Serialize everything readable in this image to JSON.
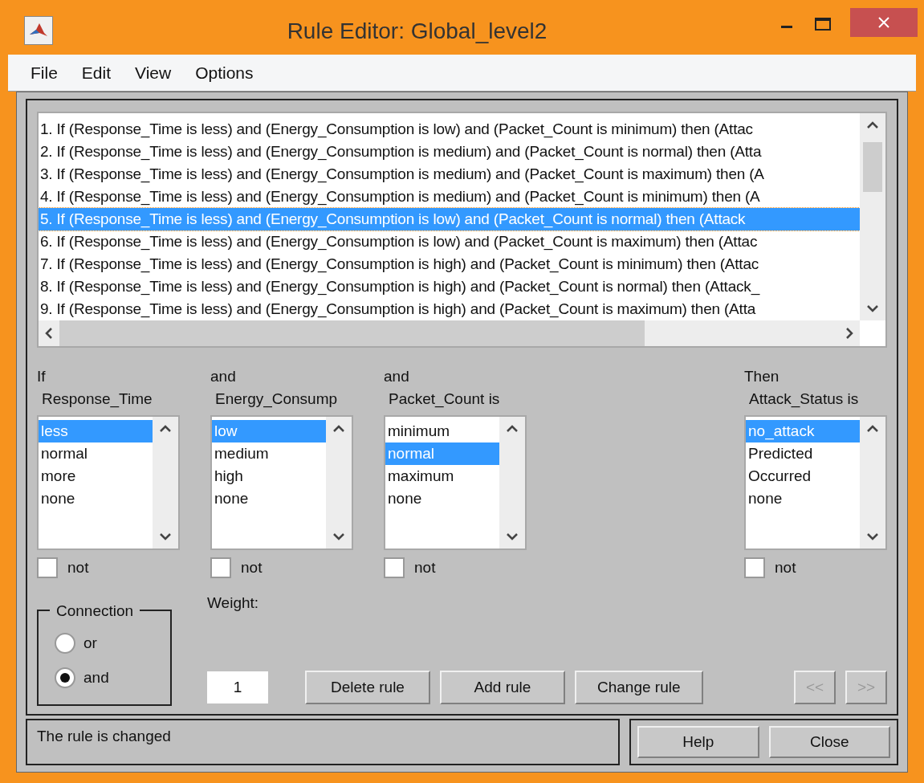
{
  "window": {
    "title": "Rule Editor: Global_level2"
  },
  "menu": [
    "File",
    "Edit",
    "View",
    "Options"
  ],
  "rules": [
    {
      "text": "1. If (Response_Time is less) and (Energy_Consumption is low) and (Packet_Count is minimum) then (Attac",
      "selected": false
    },
    {
      "text": "2. If (Response_Time is less) and (Energy_Consumption is medium) and (Packet_Count is normal) then (Atta",
      "selected": false
    },
    {
      "text": "3. If (Response_Time is less) and (Energy_Consumption is medium) and (Packet_Count is maximum) then (A",
      "selected": false
    },
    {
      "text": "4. If (Response_Time is less) and (Energy_Consumption is medium) and (Packet_Count is minimum) then (A",
      "selected": false
    },
    {
      "text": "5. If (Response_Time is less) and (Energy_Consumption is low) and (Packet_Count is normal) then (Attack",
      "selected": true
    },
    {
      "text": "6. If (Response_Time is less) and (Energy_Consumption is low) and (Packet_Count is maximum) then (Attac",
      "selected": false
    },
    {
      "text": "7. If (Response_Time is less) and (Energy_Consumption is high) and (Packet_Count is minimum) then (Attac",
      "selected": false
    },
    {
      "text": "8. If (Response_Time is less) and (Energy_Consumption is high) and (Packet_Count is normal) then (Attack_",
      "selected": false
    },
    {
      "text": "9. If (Response_Time is less) and (Energy_Consumption is high) and (Packet_Count is maximum) then (Atta",
      "selected": false
    }
  ],
  "variables": [
    {
      "connective": "If",
      "name": "Response_Time",
      "not": false,
      "not_label": "not",
      "options": [
        {
          "label": "less",
          "selected": true
        },
        {
          "label": "normal",
          "selected": false
        },
        {
          "label": "more",
          "selected": false
        },
        {
          "label": "none",
          "selected": false
        }
      ]
    },
    {
      "connective": "and",
      "name": "Energy_Consump",
      "not": false,
      "not_label": "not",
      "options": [
        {
          "label": "low",
          "selected": true
        },
        {
          "label": "medium",
          "selected": false
        },
        {
          "label": "high",
          "selected": false
        },
        {
          "label": "none",
          "selected": false
        }
      ]
    },
    {
      "connective": "and",
      "name": "Packet_Count is",
      "not": false,
      "not_label": "not",
      "options": [
        {
          "label": "minimum",
          "selected": false
        },
        {
          "label": "normal",
          "selected": true
        },
        {
          "label": "maximum",
          "selected": false
        },
        {
          "label": "none",
          "selected": false
        }
      ]
    },
    {
      "connective": "Then",
      "name": "Attack_Status is",
      "not": false,
      "not_label": "not",
      "options": [
        {
          "label": "no_attack",
          "selected": true
        },
        {
          "label": "Predicted",
          "selected": false
        },
        {
          "label": "Occurred",
          "selected": false
        },
        {
          "label": "none",
          "selected": false
        }
      ]
    }
  ],
  "connection": {
    "label": "Connection",
    "options": [
      {
        "label": "or",
        "selected": false
      },
      {
        "label": "and",
        "selected": true
      }
    ]
  },
  "weight": {
    "label": "Weight:",
    "value": "1"
  },
  "rule_buttons": [
    {
      "label": "Delete rule",
      "disabled": false
    },
    {
      "label": "Add rule",
      "disabled": false
    },
    {
      "label": "Change rule",
      "disabled": false
    }
  ],
  "nav_buttons": [
    {
      "label": "<<",
      "disabled": true
    },
    {
      "label": ">>",
      "disabled": true
    }
  ],
  "status": "The rule is changed",
  "footer_buttons": [
    "Help",
    "Close"
  ]
}
